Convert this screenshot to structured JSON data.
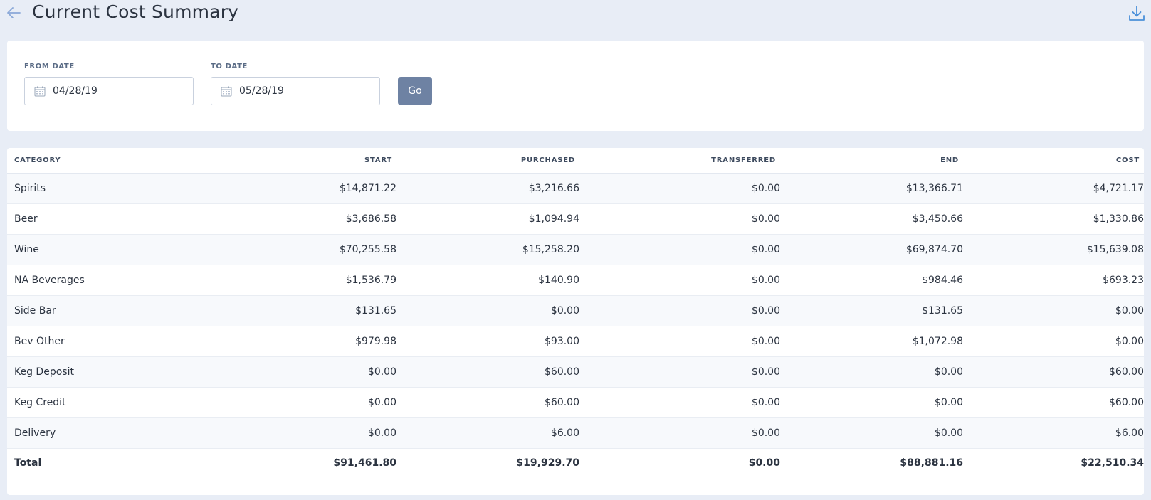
{
  "header": {
    "title": "Current Cost Summary",
    "back_icon": "arrow-left-icon",
    "download_icon": "download-icon"
  },
  "filters": {
    "from_label": "FROM DATE",
    "from_value": "04/28/19",
    "to_label": "TO DATE",
    "to_value": "05/28/19",
    "go_label": "Go"
  },
  "table": {
    "columns": [
      "CATEGORY",
      "START",
      "PURCHASED",
      "TRANSFERRED",
      "END",
      "COST"
    ],
    "rows": [
      [
        "Spirits",
        "$14,871.22",
        "$3,216.66",
        "$0.00",
        "$13,366.71",
        "$4,721.17"
      ],
      [
        "Beer",
        "$3,686.58",
        "$1,094.94",
        "$0.00",
        "$3,450.66",
        "$1,330.86"
      ],
      [
        "Wine",
        "$70,255.58",
        "$15,258.20",
        "$0.00",
        "$69,874.70",
        "$15,639.08"
      ],
      [
        "NA Beverages",
        "$1,536.79",
        "$140.90",
        "$0.00",
        "$984.46",
        "$693.23"
      ],
      [
        "Side Bar",
        "$131.65",
        "$0.00",
        "$0.00",
        "$131.65",
        "$0.00"
      ],
      [
        "Bev Other",
        "$979.98",
        "$93.00",
        "$0.00",
        "$1,072.98",
        "$0.00"
      ],
      [
        "Keg Deposit",
        "$0.00",
        "$60.00",
        "$0.00",
        "$0.00",
        "$60.00"
      ],
      [
        "Keg Credit",
        "$0.00",
        "$60.00",
        "$0.00",
        "$0.00",
        "$60.00"
      ],
      [
        "Delivery",
        "$0.00",
        "$6.00",
        "$0.00",
        "$0.00",
        "$6.00"
      ]
    ],
    "total": [
      "Total",
      "$91,461.80",
      "$19,929.70",
      "$0.00",
      "$88,881.16",
      "$22,510.34"
    ]
  },
  "colors": {
    "background": "#e8edf6",
    "accent": "#6e82a3",
    "icon_blue": "#4a90d9"
  }
}
